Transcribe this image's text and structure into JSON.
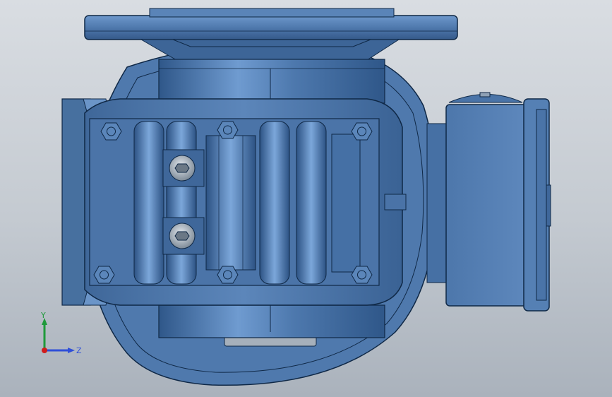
{
  "viewport": {
    "background_top": "#d9dde2",
    "background_bottom": "#aab2bc"
  },
  "model": {
    "body_color": "#4a74a8",
    "shade_color": "#2d5487",
    "highlight_color": "#7aa6d8",
    "edge_color": "#0f2846",
    "bolt_color": "#9aa6b2"
  },
  "triad": {
    "x_label": "",
    "y_label": "Y",
    "z_label": "Z",
    "y_color": "#1f9a3b",
    "z_color": "#2f4fd8",
    "origin_color": "#d01c1c"
  }
}
